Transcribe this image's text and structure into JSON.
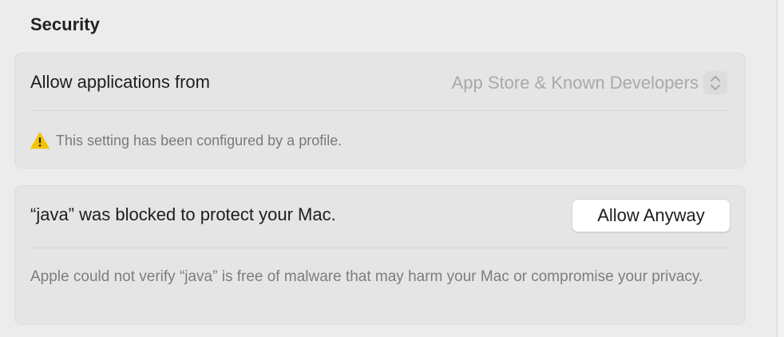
{
  "section": {
    "title": "Security"
  },
  "allow_apps": {
    "label": "Allow applications from",
    "value": "App Store & Known Developers",
    "stepper_icon": "chevron-up-down-icon",
    "note": "This setting has been configured by a profile.",
    "note_icon": "warning-icon",
    "warning_color": "#f5c400"
  },
  "blocked": {
    "message": "“java” was blocked to protect your Mac.",
    "button_label": "Allow Anyway",
    "description": "Apple could not verify “java” is free of malware that may harm your Mac or compromise your privacy."
  }
}
